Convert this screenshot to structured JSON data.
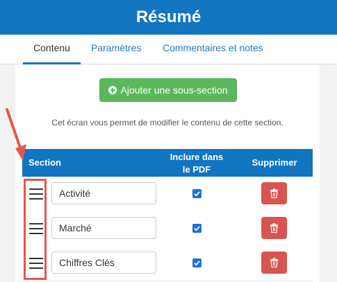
{
  "header": {
    "title": "Résumé"
  },
  "tabs": [
    {
      "label": "Contenu",
      "active": true
    },
    {
      "label": "Paramètres",
      "active": false
    },
    {
      "label": "Commentaires et notes",
      "active": false
    }
  ],
  "add_button": {
    "label": "Ajouter une sous-section",
    "icon": "plus-circle-icon"
  },
  "description": "Cet écran vous permet de modifier le contenu de cette section.",
  "table": {
    "headers": {
      "section": "Section",
      "include_line1": "Inclure dans",
      "include_line2": "le PDF",
      "delete": "Supprimer"
    },
    "rows": [
      {
        "name": "Activité",
        "include_pdf": true
      },
      {
        "name": "Marché",
        "include_pdf": true
      },
      {
        "name": "Chiffres Clés",
        "include_pdf": true
      }
    ]
  },
  "colors": {
    "header_bg": "#1175c1",
    "add_button": "#5cb85c",
    "delete_button": "#d9534f",
    "annotation": "#e2574c"
  }
}
